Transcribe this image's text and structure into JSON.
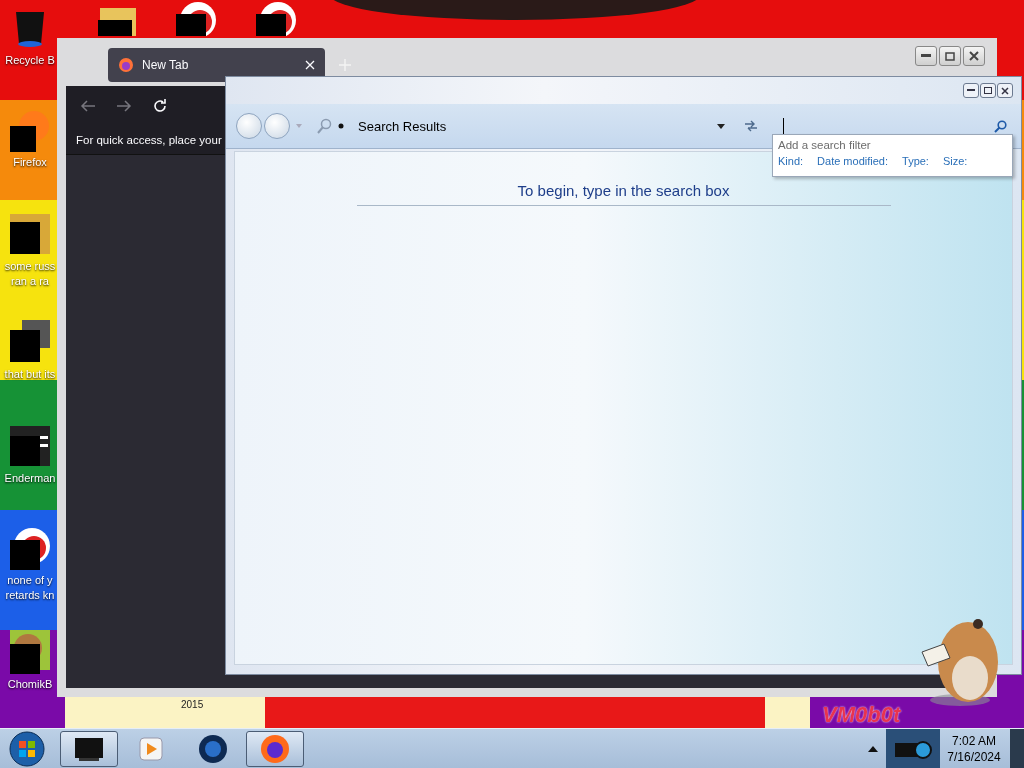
{
  "desktop": {
    "icons": [
      {
        "kind": "bin",
        "lines": [
          "Recycle B"
        ]
      },
      {
        "kind": "fox",
        "lines": [
          "Firefox"
        ]
      },
      {
        "kind": "photo",
        "lines": [
          "some russ",
          "ran a ra"
        ]
      },
      {
        "kind": "stack",
        "lines": [
          "that but its"
        ]
      },
      {
        "kind": "panel",
        "lines": [
          "Enderman"
        ]
      },
      {
        "kind": "ring",
        "lines": [
          "none of y",
          "retards kn"
        ]
      },
      {
        "kind": "rodent",
        "lines": [
          "ChomikB"
        ]
      }
    ],
    "top_icons": [
      {
        "kind": "folder"
      },
      {
        "kind": "ring"
      },
      {
        "kind": "ring"
      }
    ],
    "wallpaper_texts": [
      "2015",
      "VM0b0t"
    ]
  },
  "browser": {
    "tabs": [
      {
        "label": "New Tab",
        "selected": true
      }
    ],
    "bookmarks_hint": "For quick access, place your"
  },
  "explorer": {
    "address": "Search Results",
    "filter_popup": {
      "title": "Add a search filter",
      "filters": [
        "Kind:",
        "Date modified:",
        "Type:",
        "Size:"
      ]
    },
    "message": "To begin, type in the search box"
  },
  "taskbar": {
    "buttons": [
      {
        "kind": "terminal",
        "selected": true
      },
      {
        "kind": "media",
        "selected": false
      },
      {
        "kind": "globe",
        "selected": false
      },
      {
        "kind": "fox",
        "selected": true
      }
    ],
    "clock": {
      "time": "7:02 AM",
      "date": "7/16/2024"
    }
  }
}
